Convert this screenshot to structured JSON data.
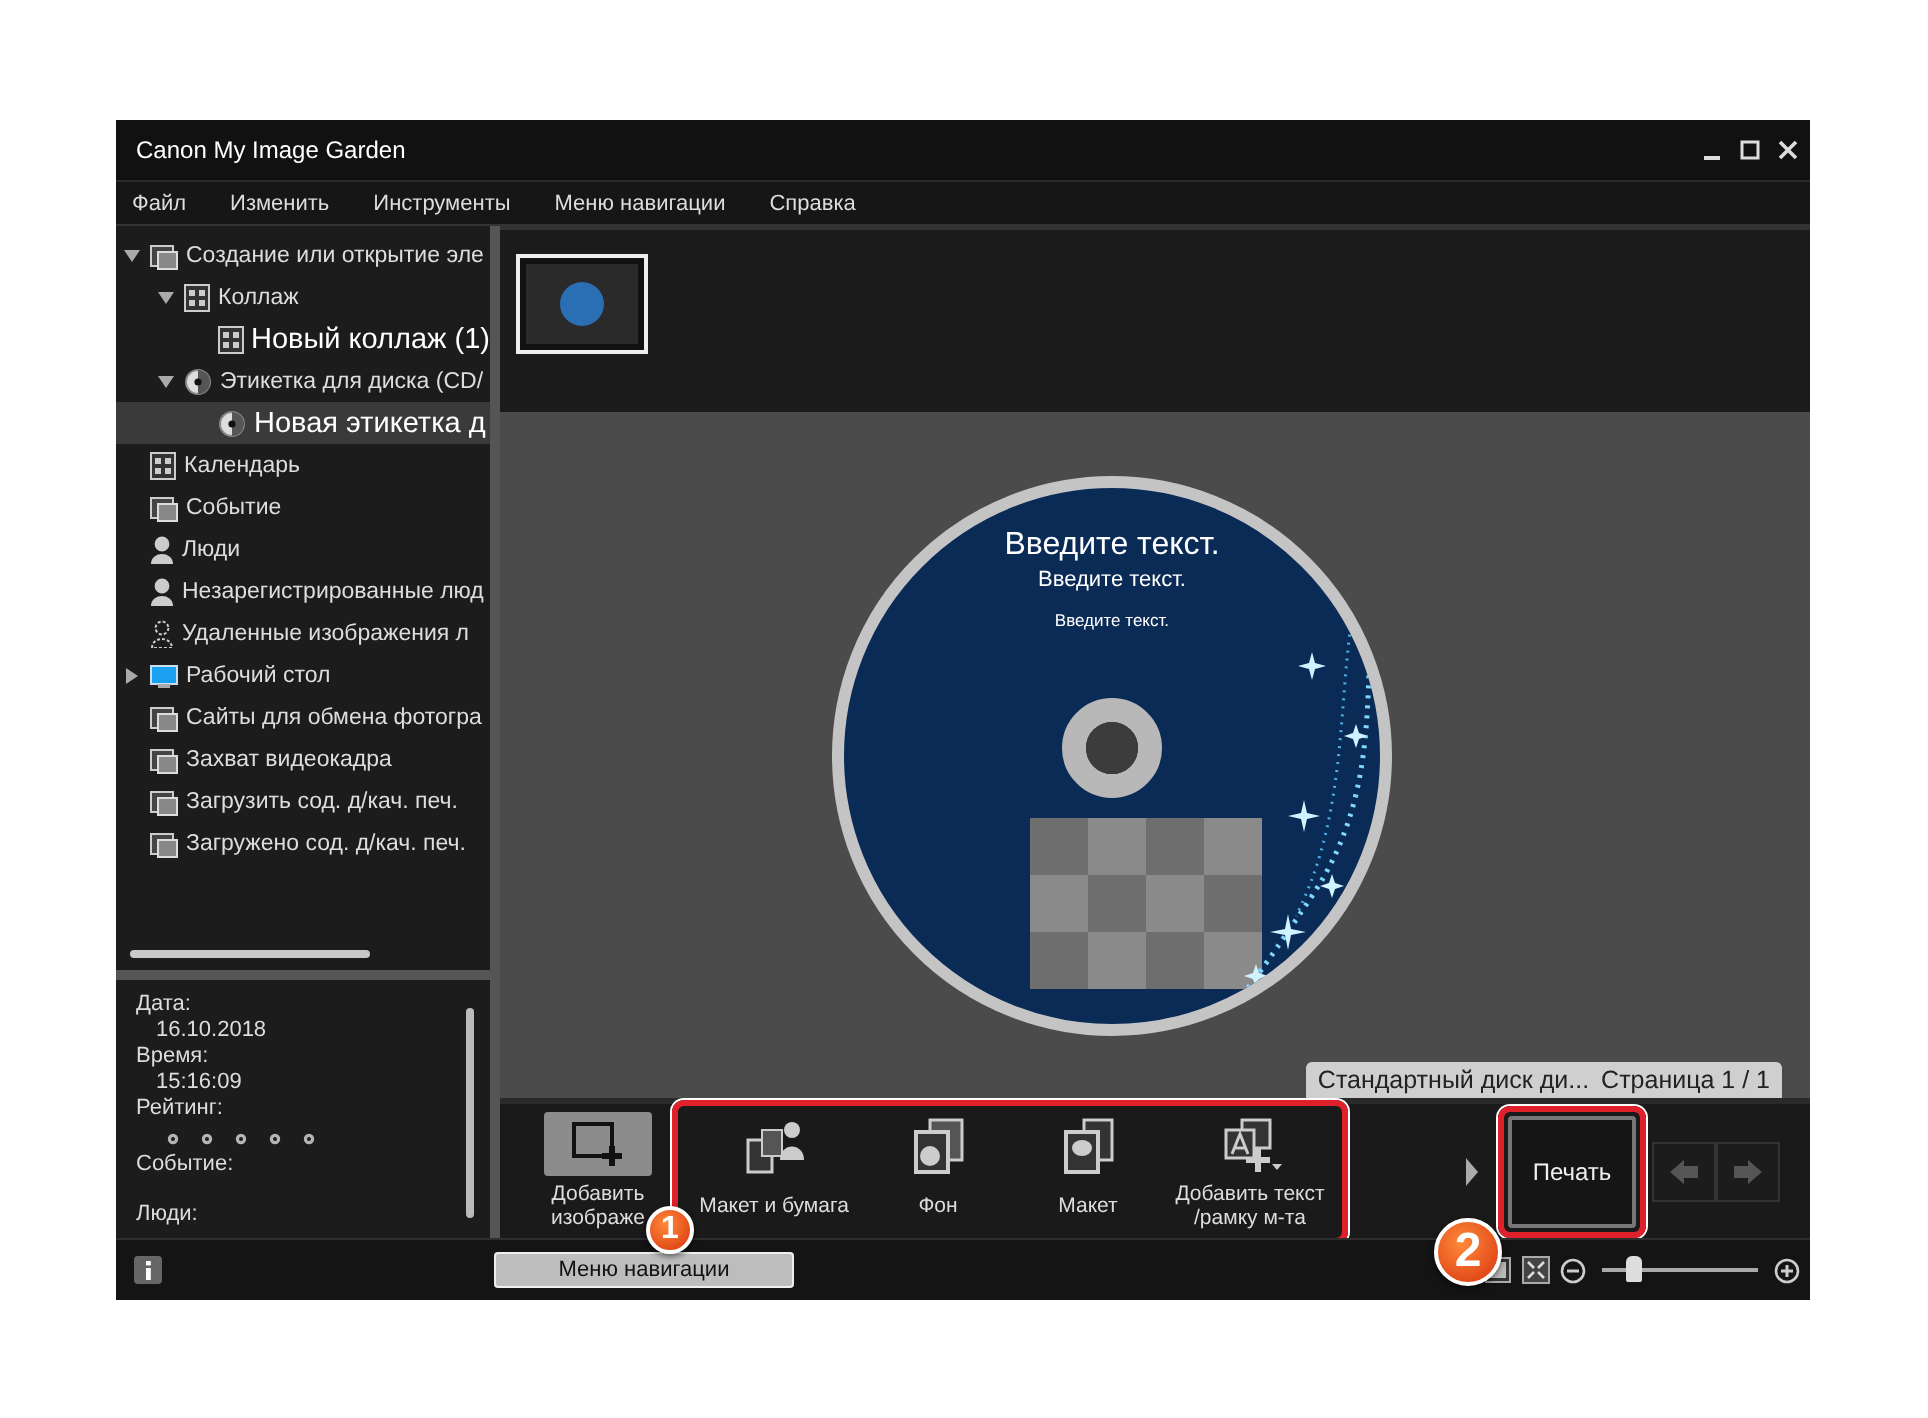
{
  "window": {
    "title": "Canon My Image Garden"
  },
  "menu": [
    "Файл",
    "Изменить",
    "Инструменты",
    "Меню навигации",
    "Справка"
  ],
  "sidebar": {
    "items": [
      {
        "label": "Создание или открытие эле",
        "expanded": true,
        "selected": false,
        "children": [
          {
            "label": "Коллаж",
            "expanded": true,
            "selected": false,
            "children": [
              {
                "label": "Новый коллаж (1)",
                "selected": false
              }
            ]
          },
          {
            "label": "Этикетка для диска (CD/",
            "expanded": true,
            "selected": false,
            "children": [
              {
                "label": "Новая этикетка д",
                "selected": true
              }
            ]
          }
        ]
      },
      {
        "label": "Календарь",
        "selected": false
      },
      {
        "label": "Событие",
        "selected": false
      },
      {
        "label": "Люди",
        "selected": false
      },
      {
        "label": "Незарегистрированные люд",
        "selected": false
      },
      {
        "label": "Удаленные изображения л",
        "selected": false
      },
      {
        "label": "Рабочий стол",
        "expanded": false,
        "selected": false
      },
      {
        "label": "Сайты для обмена фотогра",
        "selected": false
      },
      {
        "label": "Захват видеокадра",
        "selected": false
      },
      {
        "label": "Загрузить сод. д/кач. печ.",
        "selected": false
      },
      {
        "label": "Загружено сод. д/кач. печ.",
        "selected": false
      }
    ]
  },
  "info": {
    "fields": [
      {
        "label": "Дата:",
        "value": "16.10.2018"
      },
      {
        "label": "Время:",
        "value": "15:16:09"
      },
      {
        "label": "Рейтинг:",
        "stars": 0
      },
      {
        "label": "Событие:"
      },
      {
        "label": "Люди:"
      }
    ]
  },
  "disc": {
    "texts": [
      "Введите текст.",
      "Введите текст.",
      "Введите текст."
    ]
  },
  "page_tab": {
    "title": "Стандартный диск ди...",
    "page": "Страница 1 / 1"
  },
  "toolbar": {
    "add_button": {
      "lines": [
        "Добавить",
        "изображе"
      ]
    },
    "group_highlighted": true,
    "items": [
      {
        "label": "Макет и бумага"
      },
      {
        "label": "Фон"
      },
      {
        "label": "Макет"
      },
      {
        "label": "Добавить текст\n/рамку м-та"
      }
    ],
    "print_button": {
      "label": "Печать",
      "highlighted": true
    }
  },
  "status_bar": {
    "nav_button": "Меню навигации",
    "zoom": {
      "level": 0.2
    }
  },
  "annotations": [
    {
      "number": "1"
    },
    {
      "number": "2"
    }
  ]
}
